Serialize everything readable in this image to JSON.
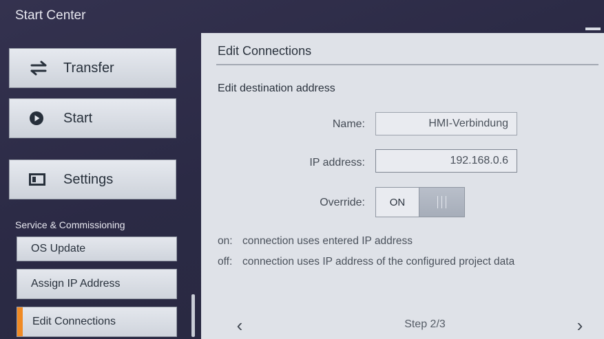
{
  "app": {
    "title": "Start Center"
  },
  "sidebar": {
    "buttons": [
      {
        "label": "Transfer",
        "icon": "transfer-arrows-icon"
      },
      {
        "label": "Start",
        "icon": "play-circle-icon"
      },
      {
        "label": "Settings",
        "icon": "settings-panel-icon"
      }
    ],
    "section_label": "Service & Commissioning",
    "sub_items": [
      {
        "label": "OS Update"
      },
      {
        "label": "Assign IP Address"
      },
      {
        "label": "Edit Connections",
        "active": true
      }
    ],
    "active_color": "#f08a24"
  },
  "panel": {
    "title": "Edit Connections",
    "subtitle": "Edit destination address",
    "fields": {
      "name": {
        "label": "Name:",
        "value": "HMI-Verbindung"
      },
      "ip": {
        "label": "IP address:",
        "value": "192.168.0.6"
      },
      "override": {
        "label": "Override:",
        "state": "ON"
      }
    },
    "notes": [
      {
        "key": "on:",
        "text": "connection uses entered IP address"
      },
      {
        "key": "off:",
        "text": "connection uses IP address of the configured project data"
      }
    ],
    "footer": {
      "prev": "‹",
      "step": "Step 2/3",
      "next": "›"
    }
  }
}
